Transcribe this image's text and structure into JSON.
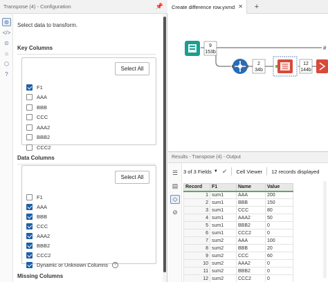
{
  "config": {
    "title": "Transpose (4) - Configuration",
    "intro": "Select data to transform.",
    "key_columns": {
      "title": "Key Columns",
      "select_all_label": "Select All",
      "items": [
        {
          "label": "F1",
          "checked": true
        },
        {
          "label": "AAA",
          "checked": false
        },
        {
          "label": "BBB",
          "checked": false
        },
        {
          "label": "CCC",
          "checked": false
        },
        {
          "label": "AAA2",
          "checked": false
        },
        {
          "label": "BBB2",
          "checked": false
        },
        {
          "label": "CCC2",
          "checked": false
        }
      ]
    },
    "data_columns": {
      "title": "Data Columns",
      "select_all_label": "Select All",
      "items": [
        {
          "label": "F1",
          "checked": false
        },
        {
          "label": "AAA",
          "checked": true
        },
        {
          "label": "BBB",
          "checked": true
        },
        {
          "label": "CCC",
          "checked": true
        },
        {
          "label": "AAA2",
          "checked": true
        },
        {
          "label": "BBB2",
          "checked": true
        },
        {
          "label": "CCC2",
          "checked": true
        },
        {
          "label": "Dynamic or Unknown Columns",
          "checked": true
        }
      ]
    },
    "missing_columns_title": "Missing Columns"
  },
  "canvas": {
    "tab_label": "Create difference row.yxmd",
    "tab_close": "✕",
    "new_tab": "+",
    "badges": {
      "input_top": "9",
      "input_bottom": "153b",
      "select_top": "2",
      "select_bottom": "34b",
      "transpose_top": "12",
      "transpose_bottom": "144b"
    },
    "hash_mark": "#"
  },
  "results": {
    "title": "Results - Transpose (4) - Output",
    "fields_label": "3 of 3 Fields",
    "viewer_label": "Cell Viewer",
    "records_label": "12 records displayed",
    "columns": [
      "Record",
      "F1",
      "Name",
      "Value"
    ],
    "rows": [
      [
        "1",
        "sum1",
        "AAA",
        "200"
      ],
      [
        "2",
        "sum1",
        "BBB",
        "150"
      ],
      [
        "3",
        "sum1",
        "CCC",
        "80"
      ],
      [
        "4",
        "sum1",
        "AAA2",
        "50"
      ],
      [
        "5",
        "sum1",
        "BBB2",
        "0"
      ],
      [
        "6",
        "sum1",
        "CCC2",
        "0"
      ],
      [
        "7",
        "sum2",
        "AAA",
        "100"
      ],
      [
        "8",
        "sum2",
        "BBB",
        "20"
      ],
      [
        "9",
        "sum2",
        "CCC",
        "60"
      ],
      [
        "10",
        "sum2",
        "AAA2",
        "0"
      ],
      [
        "11",
        "sum2",
        "BBB2",
        "0"
      ],
      [
        "12",
        "sum2",
        "CCC2",
        "0"
      ]
    ]
  },
  "colors": {
    "accent_blue": "#1e5fa8",
    "header_green": "#5ea85a",
    "input_tool_teal": "#1b9e8f",
    "select_tool_blue": "#2a6cb4",
    "transpose_tool_red": "#d84a3a",
    "browse_tool_green": "#3f8f4e"
  }
}
